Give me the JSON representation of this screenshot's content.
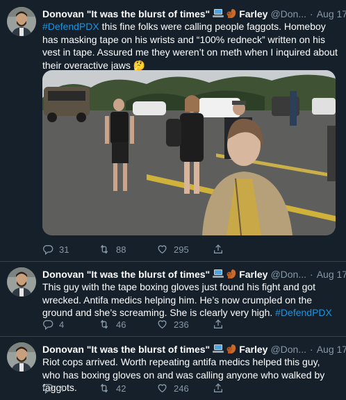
{
  "tweets": [
    {
      "display_name": "Donovan \"It was the blurst of times\"",
      "name_suffix": "Farley",
      "handle": "@Don...",
      "separator": "·",
      "time": "Aug 17",
      "text_parts": {
        "hashtag": "#DefendPDX",
        "rest": " this fine folks were calling people faggots. Homeboy has masking tape on his wrists and “100% redneck” written on his vest in tape. Assured me they weren’t on meth when I inquired about their overactive jaws 🤔"
      },
      "replies": "31",
      "retweets": "88",
      "likes": "295"
    },
    {
      "display_name": "Donovan \"It was the blurst of times\"",
      "name_suffix": "Farley",
      "handle": "@Don...",
      "separator": "·",
      "time": "Aug 17",
      "text_parts": {
        "main": "This guy with the tape boxing gloves just found his fight and got wrecked. Antifa medics helping him. He’s now crumpled on the ground and she’s screaming. She is clearly very high. ",
        "hashtag": "#DefendPDX"
      },
      "replies": "4",
      "retweets": "46",
      "likes": "236"
    },
    {
      "display_name": "Donovan \"It was the blurst of times\"",
      "name_suffix": "Farley",
      "handle": "@Don...",
      "separator": "·",
      "time": "Aug 17",
      "text": "Riot cops arrived. Worth repeating antifa medics helped this guy, who has boxing gloves on and was calling anyone who walked by faggots.",
      "replies": "4",
      "retweets": "42",
      "likes": "246"
    }
  ],
  "icons": {
    "reply": "reply-icon",
    "retweet": "retweet-icon",
    "like": "heart-icon",
    "share": "share-icon",
    "laptop": "laptop-emoji",
    "squirrel": "squirrel-emoji"
  },
  "colors": {
    "background": "#15202b",
    "text": "#ffffff",
    "muted": "#8899a6",
    "link": "#1b95e0",
    "divider": "#38444d"
  }
}
